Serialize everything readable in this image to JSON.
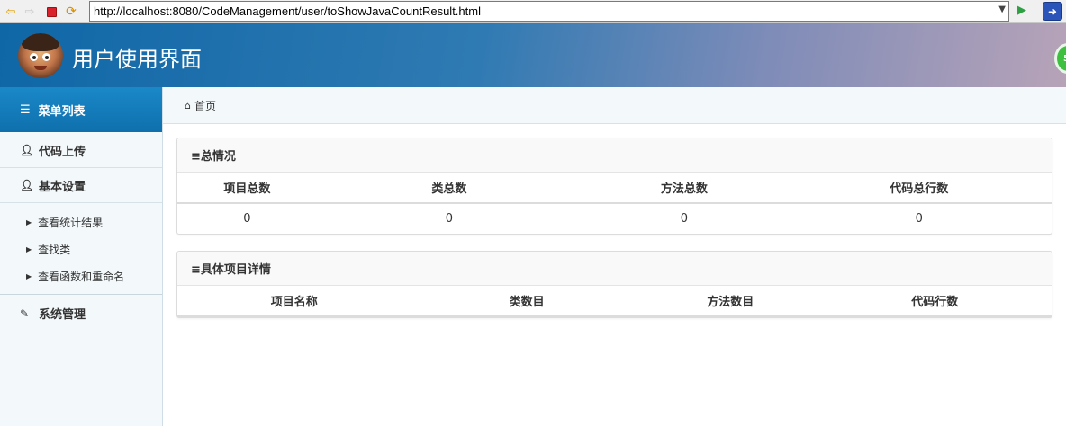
{
  "browser": {
    "url": "http://localhost:8080/CodeManagement/user/toShowJavaCountResult.html"
  },
  "header": {
    "title": "用户使用界面",
    "badge": "5"
  },
  "sidebar": {
    "menu_title": "菜单列表",
    "items": [
      {
        "label": "代码上传"
      },
      {
        "label": "基本设置"
      }
    ],
    "sub_items": [
      {
        "label": "查看统计结果"
      },
      {
        "label": "查找类"
      },
      {
        "label": "查看函数和重命名"
      }
    ],
    "system": {
      "label": "系统管理"
    }
  },
  "breadcrumb": {
    "home": "首页"
  },
  "summary": {
    "title": "≡总情况",
    "columns": [
      "项目总数",
      "类总数",
      "方法总数",
      "代码总行数"
    ],
    "values": [
      "0",
      "0",
      "0",
      "0"
    ]
  },
  "details": {
    "title": "≡具体项目详情",
    "columns": [
      "项目名称",
      "类数目",
      "方法数目",
      "代码行数"
    ]
  },
  "colors": {
    "accent": "#0f70ad",
    "sidebar_bg": "#f3f8fb"
  }
}
